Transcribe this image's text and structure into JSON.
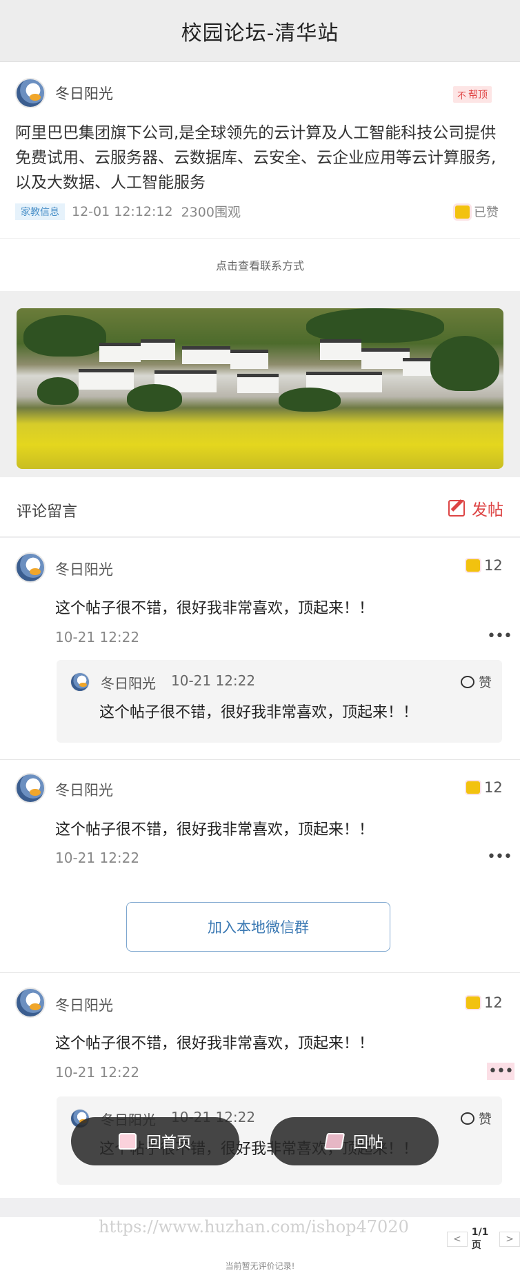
{
  "header": {
    "title": "校园论坛-清华站"
  },
  "post": {
    "author": "冬日阳光",
    "pin_label": "帮顶",
    "body": "阿里巴巴集团旗下公司,是全球领先的云计算及人工智能科技公司提供免费试用、云服务器、云数据库、云安全、云企业应用等云计算服务,以及大数据、人工智能服务",
    "tag": "家教信息",
    "time": "12-01 12:12:12",
    "views": "2300围观",
    "liked_label": "已赞",
    "contact_label": "点击查看联系方式"
  },
  "comments_section": {
    "title": "评论留言",
    "post_button": "发帖"
  },
  "comments": [
    {
      "author": "冬日阳光",
      "likes": "12",
      "text": "这个帖子很不错，很好我非常喜欢，顶起来！！",
      "time": "10-21 12:22",
      "more": "•••",
      "reply": {
        "author": "冬日阳光",
        "time": "10-21 12:22",
        "like_label": "赞",
        "text": "这个帖子很不错，很好我非常喜欢，顶起来！！"
      }
    },
    {
      "author": "冬日阳光",
      "likes": "12",
      "text": "这个帖子很不错，很好我非常喜欢，顶起来！！",
      "time": "10-21 12:22",
      "more": "•••"
    },
    {
      "author": "冬日阳光",
      "likes": "12",
      "text": "这个帖子很不错，很好我非常喜欢，顶起来！！",
      "time": "10-21 12:22",
      "more": "•••",
      "reply": {
        "author": "冬日阳光",
        "time": "10-21 12:22",
        "like_label": "赞",
        "text": "这个帖子很不错，很好我非常喜欢，顶起来！！"
      }
    }
  ],
  "wechat_button": "加入本地微信群",
  "floating": {
    "home": "回首页",
    "post": "回帖"
  },
  "footer": {
    "watermark": "https://www.huzhan.com/ishop47020",
    "pager_prev": "<",
    "pager_page": "1/1页",
    "pager_next": ">",
    "empty_text": "当前暂无评价记录!"
  },
  "colors": {
    "accent_red": "#dd4444",
    "like_yellow": "#f2c20f",
    "link_blue": "#3b79b3"
  }
}
